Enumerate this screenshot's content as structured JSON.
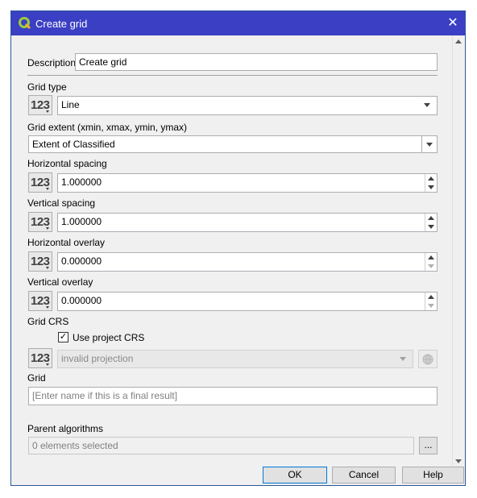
{
  "window": {
    "title": "Create grid",
    "close_glyph": "✕"
  },
  "description": {
    "label": "Description",
    "value": "Create grid"
  },
  "grid_type": {
    "label": "Grid type",
    "value": "Line"
  },
  "grid_extent": {
    "label": "Grid extent (xmin, xmax, ymin, ymax)",
    "value": "Extent of Classified"
  },
  "horizontal_spacing": {
    "label": "Horizontal spacing",
    "value": "1.000000"
  },
  "vertical_spacing": {
    "label": "Vertical spacing",
    "value": "1.000000"
  },
  "horizontal_overlay": {
    "label": "Horizontal overlay",
    "value": "0.000000"
  },
  "vertical_overlay": {
    "label": "Vertical overlay",
    "value": "0.000000"
  },
  "grid_crs": {
    "label": "Grid CRS",
    "checkbox_label": "Use project CRS",
    "checked": true,
    "value": "invalid projection"
  },
  "grid_output": {
    "label": "Grid",
    "placeholder": "[Enter name if this is a final result]"
  },
  "parent_algorithms": {
    "label": "Parent algorithms",
    "value": "0 elements selected",
    "button": "..."
  },
  "data_defined_button": "123",
  "buttons": {
    "ok": "OK",
    "cancel": "Cancel",
    "help": "Help"
  },
  "colors": {
    "titlebar": "#3b3fc4",
    "accent": "#0078d7"
  }
}
